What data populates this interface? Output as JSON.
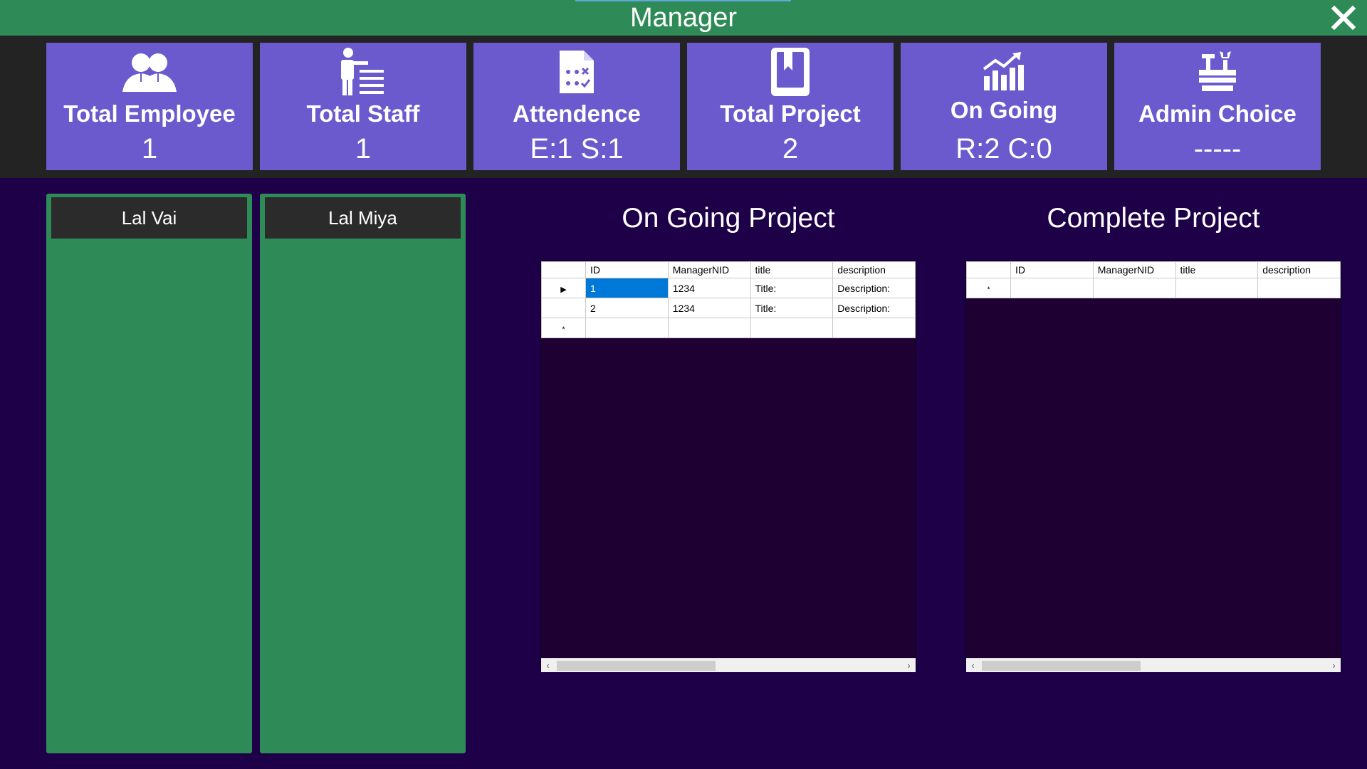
{
  "window": {
    "title": "Manager",
    "close_icon": "close-icon"
  },
  "stats": [
    {
      "icon": "people-icon",
      "label": "Total Employee",
      "value": "1"
    },
    {
      "icon": "staff-list-icon",
      "label": "Total Staff",
      "value": "1"
    },
    {
      "icon": "attendance-document-icon",
      "label": "Attendence",
      "value": "E:1 S:1"
    },
    {
      "icon": "book-icon",
      "label": "Total Project",
      "value": "2"
    },
    {
      "icon": "growth-chart-icon",
      "label": "On Going",
      "value": "R:2 C:0"
    },
    {
      "icon": "toolbox-icon",
      "label": "Admin Choice",
      "value": "-----"
    }
  ],
  "employees": [
    {
      "name": "Lal Vai"
    },
    {
      "name": "Lal Miya"
    }
  ],
  "ongoing": {
    "heading": "On Going Project",
    "columns": [
      "ID",
      "ManagerNID",
      "title",
      "description"
    ],
    "rows": [
      {
        "id": "1",
        "manager_nid": "1234",
        "title": "Title:",
        "description": "Description:"
      },
      {
        "id": "2",
        "manager_nid": "1234",
        "title": "Title:",
        "description": "Description:"
      }
    ],
    "current_row_marker": "▶",
    "new_row_marker": "*"
  },
  "complete": {
    "heading": "Complete Project",
    "columns": [
      "ID",
      "ManagerNID",
      "title",
      "description"
    ],
    "rows": [],
    "new_row_marker": "*"
  },
  "colors": {
    "title_bar": "#2e8b57",
    "card": "#6a5acd",
    "background": "#1d0048",
    "selection": "#0078d7"
  }
}
